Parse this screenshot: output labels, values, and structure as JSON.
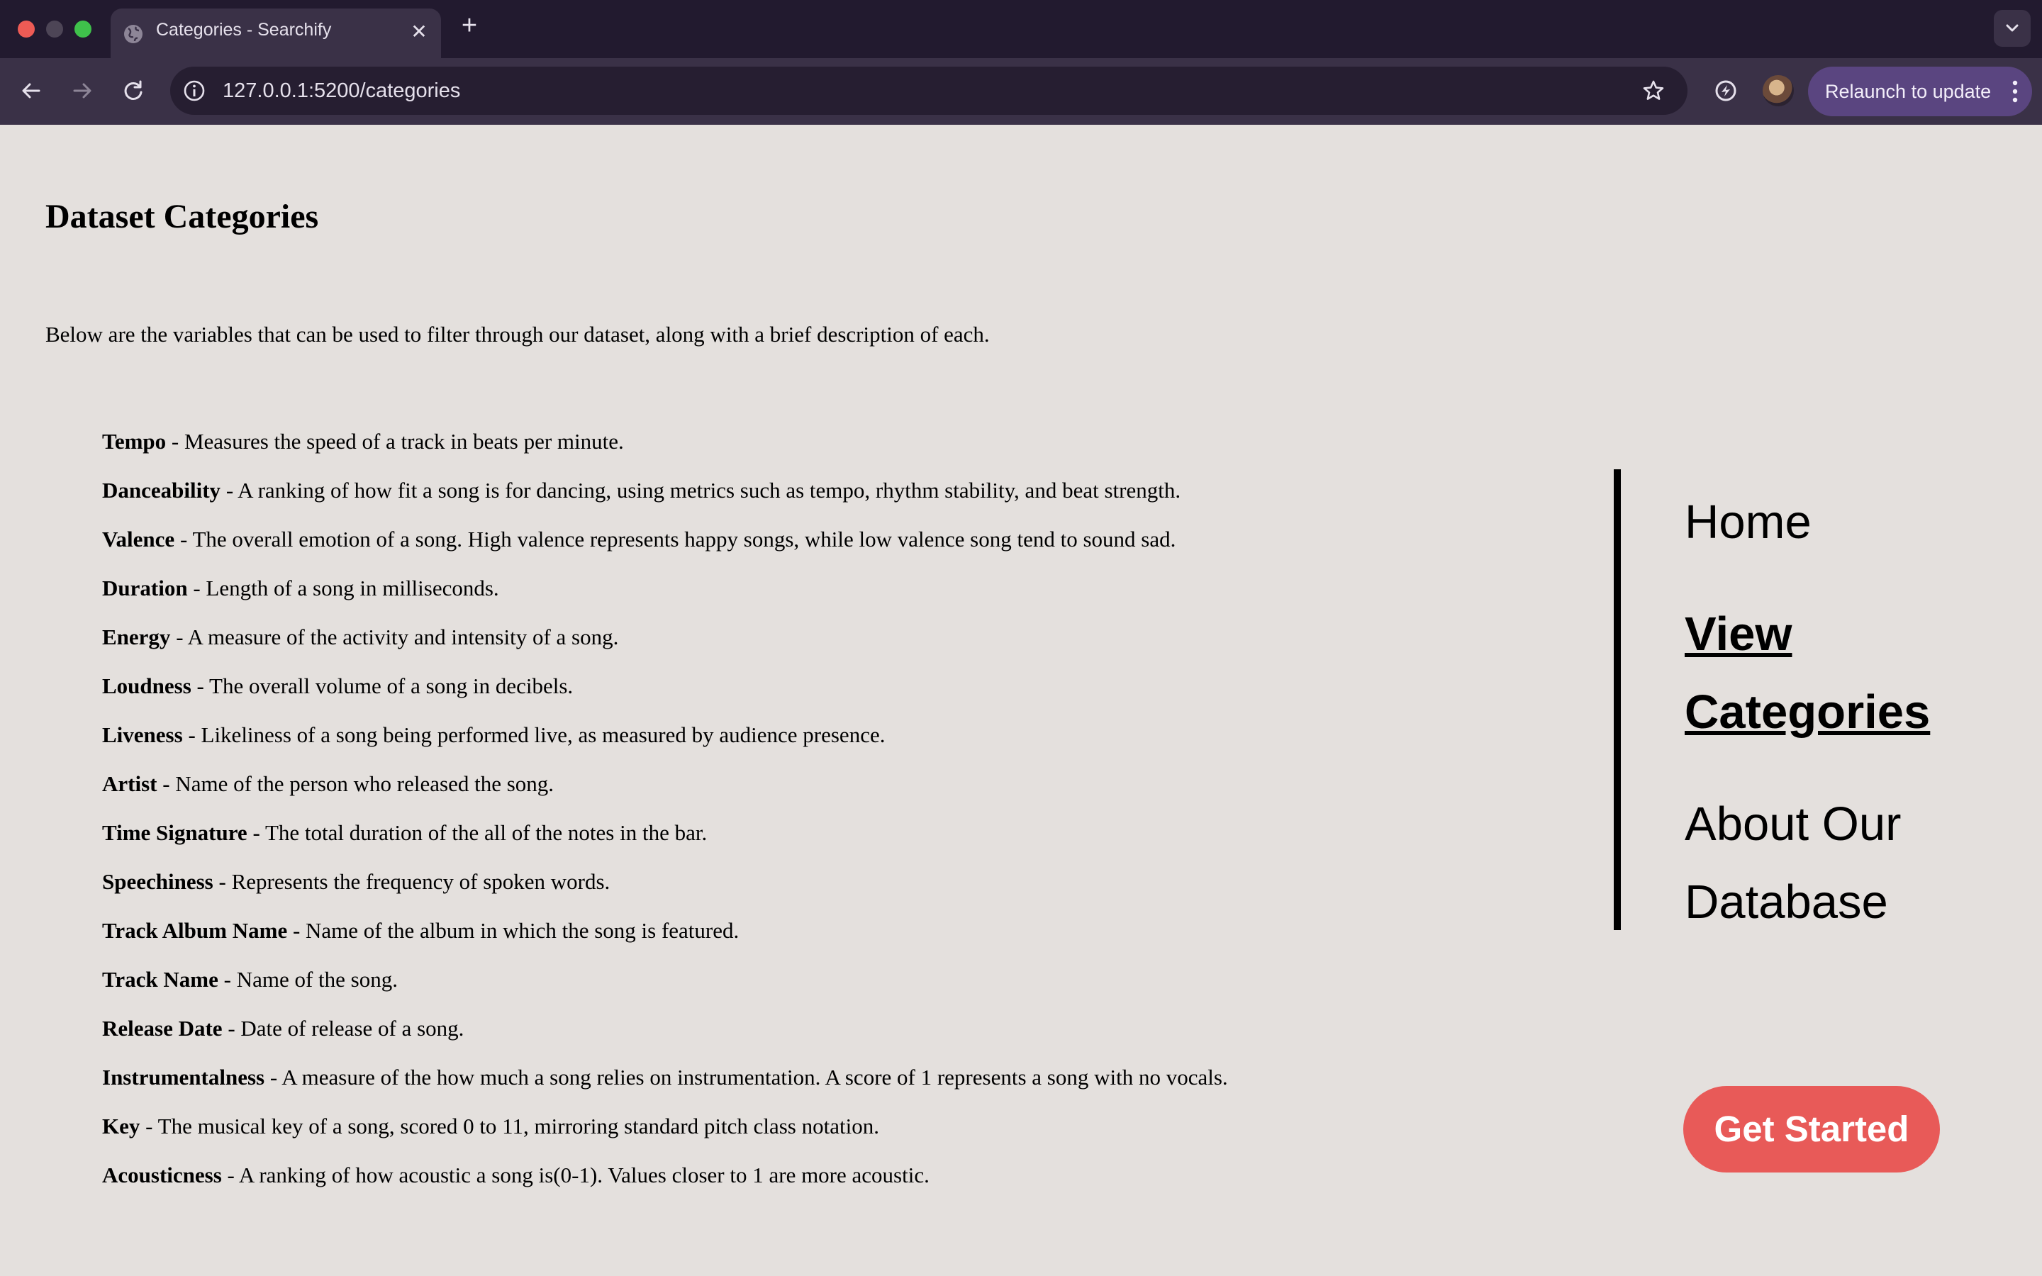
{
  "browser": {
    "tab_title": "Categories - Searchify",
    "tab_close": "✕",
    "new_tab": "+",
    "url": "127.0.0.1:5200/categories",
    "relaunch_label": "Relaunch to update"
  },
  "page": {
    "title": "Dataset Categories",
    "intro": "Below are the variables that can be used to filter through our dataset, along with a brief description of each.",
    "categories": [
      {
        "name": "Tempo",
        "description": " - Measures the speed of a track in beats per minute."
      },
      {
        "name": "Danceability",
        "description": " - A ranking of how fit a song is for dancing, using metrics such as tempo, rhythm stability, and beat strength."
      },
      {
        "name": "Valence",
        "description": " - The overall emotion of a song. High valence represents happy songs, while low valence song tend to sound sad."
      },
      {
        "name": "Duration",
        "description": " - Length of a song in milliseconds."
      },
      {
        "name": "Energy",
        "description": " - A measure of the activity and intensity of a song."
      },
      {
        "name": "Loudness",
        "description": " - The overall volume of a song in decibels."
      },
      {
        "name": "Liveness",
        "description": " - Likeliness of a song being performed live, as measured by audience presence."
      },
      {
        "name": "Artist",
        "description": " - Name of the person who released the song."
      },
      {
        "name": "Time Signature",
        "description": " - The total duration of the all of the notes in the bar."
      },
      {
        "name": "Speechiness",
        "description": " - Represents the frequency of spoken words."
      },
      {
        "name": "Track Album Name",
        "description": " - Name of the album in which the song is featured."
      },
      {
        "name": "Track Name",
        "description": " - Name of the song."
      },
      {
        "name": "Release Date",
        "description": " - Date of release of a song."
      },
      {
        "name": "Instrumentalness",
        "description": " - A measure of the how much a song relies on instrumentation. A score of 1 represents a song with no vocals."
      },
      {
        "name": "Key",
        "description": " - The musical key of a song, scored 0 to 11, mirroring standard pitch class notation."
      },
      {
        "name": "Acousticness",
        "description": " - A ranking of how acoustic a song is(0-1). Values closer to 1 are more acoustic."
      }
    ]
  },
  "nav": {
    "home": "Home",
    "view_1": "View",
    "view_2": "Categories",
    "about_1": "About Our",
    "about_2": "Database"
  },
  "cta_label": "Get Started",
  "colors": {
    "page_bg": "#e4e0dd",
    "tabbar_bg": "#221a2f",
    "toolbar_bg": "#3a3147",
    "relaunch_bg": "#5a4580",
    "cta_bg": "#e85a58"
  },
  "icons": [
    "globe-icon",
    "close-icon",
    "plus-icon",
    "chevron-down-icon",
    "back-arrow-icon",
    "forward-arrow-icon",
    "reload-icon",
    "site-info-icon",
    "star-icon",
    "extension-icon",
    "more-vert-icon"
  ]
}
